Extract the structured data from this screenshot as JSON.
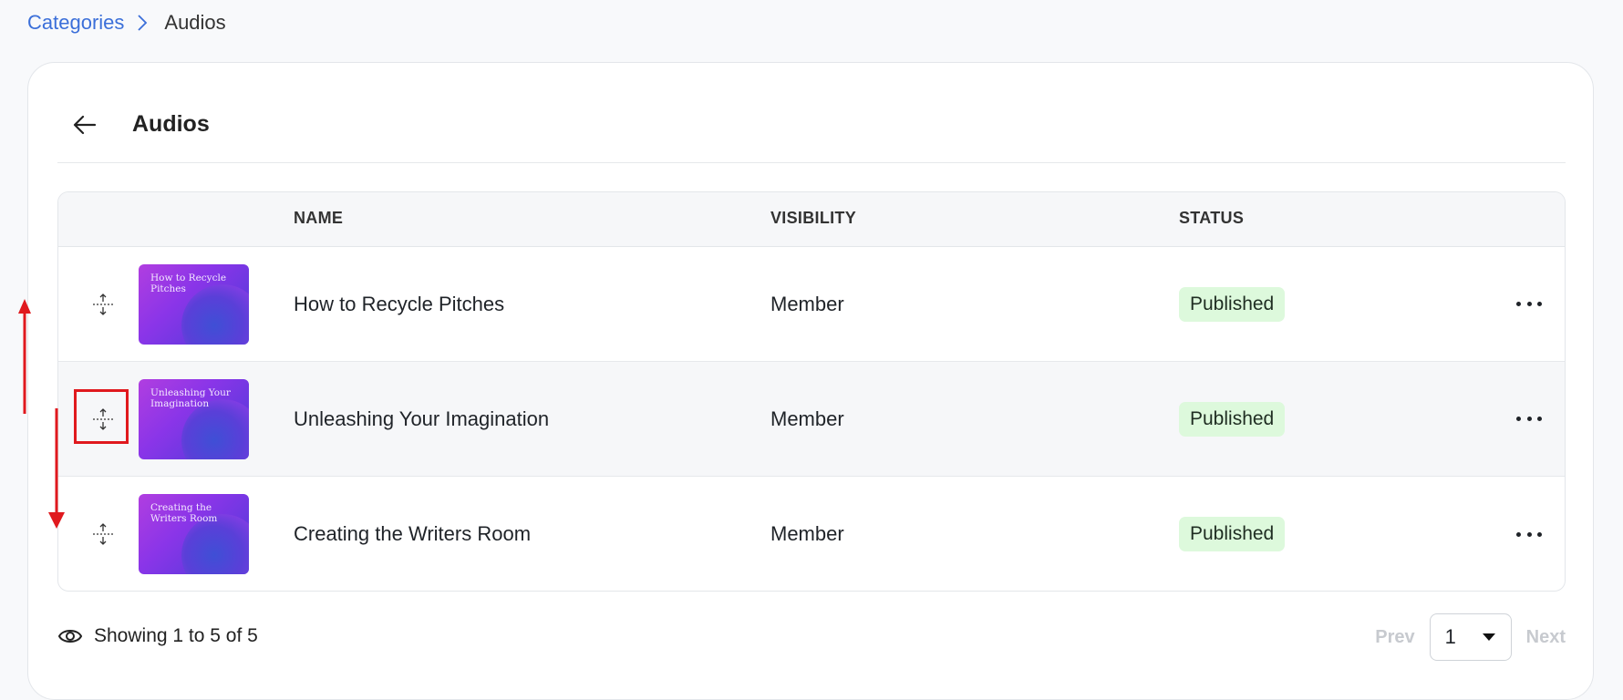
{
  "breadcrumb": {
    "parent": "Categories",
    "current": "Audios"
  },
  "header": {
    "title": "Audios"
  },
  "table": {
    "columns": {
      "name": "NAME",
      "visibility": "VISIBILITY",
      "status": "STATUS"
    },
    "rows": [
      {
        "thumb_title": "How to Recycle Pitches",
        "name": "How to Recycle Pitches",
        "visibility": "Member",
        "status": "Published"
      },
      {
        "thumb_title": "Unleashing Your Imagination",
        "name": "Unleashing Your Imagination",
        "visibility": "Member",
        "status": "Published"
      },
      {
        "thumb_title": "Creating the Writers Room",
        "name": "Creating the Writers Room",
        "visibility": "Member",
        "status": "Published"
      }
    ]
  },
  "footer": {
    "showing": "Showing 1 to 5 of 5",
    "prev": "Prev",
    "next": "Next",
    "page": "1"
  },
  "colors": {
    "accent": "#3b6fd9",
    "badge_bg": "#ddf9dc",
    "annotation": "#e0191e"
  }
}
